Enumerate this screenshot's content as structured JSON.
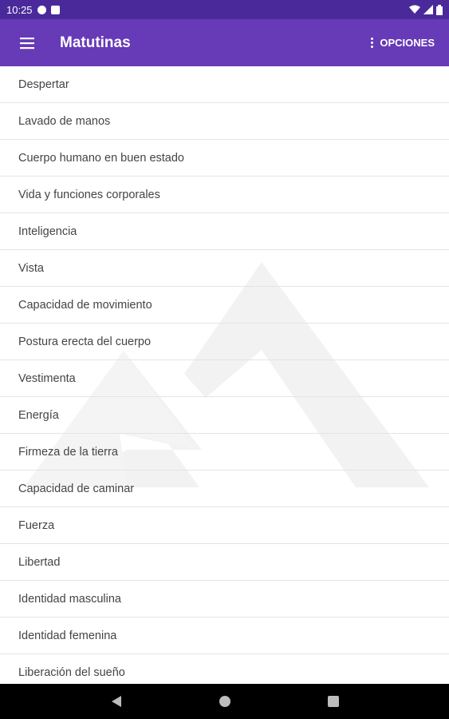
{
  "status_bar": {
    "time": "10:25"
  },
  "app_bar": {
    "title": "Matutinas",
    "options_label": "OPCIONES"
  },
  "list": {
    "items": [
      "Despertar",
      "Lavado de manos",
      "Cuerpo humano en buen estado",
      "Vida y funciones corporales",
      "Inteligencia",
      "Vista",
      "Capacidad de movimiento",
      "Postura erecta del cuerpo",
      "Vestimenta",
      "Energía",
      "Firmeza de la tierra",
      "Capacidad de caminar",
      "Fuerza",
      "Libertad",
      "Identidad masculina",
      "Identidad femenina",
      "Liberación del sueño"
    ]
  },
  "colors": {
    "status_bar": "#4a2a9a",
    "app_bar": "#673ab7",
    "nav_bar": "#000000"
  },
  "icons": {
    "menu": "hamburger-icon",
    "options": "more-vert-icon",
    "back": "back-triangle-icon",
    "home": "home-circle-icon",
    "recents": "recents-square-icon"
  }
}
